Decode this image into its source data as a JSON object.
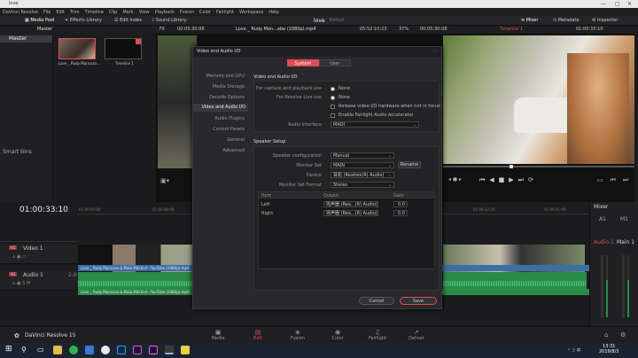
{
  "window": {
    "title": "love"
  },
  "menu": [
    "DaVinci Resolve",
    "File",
    "Edit",
    "Trim",
    "Timeline",
    "Clip",
    "Mark",
    "View",
    "Playback",
    "Fusion",
    "Color",
    "Fairlight",
    "Workspace",
    "Help"
  ],
  "toolbar": {
    "media_pool": "Media Pool",
    "effects_library": "Effects Library",
    "edit_index": "Edit Index",
    "sound_library": "Sound Library",
    "project_name": "love",
    "project_status": "Edited",
    "mixer": "Mixer",
    "metadata": "Metadata",
    "inspector": "Inspector"
  },
  "subbar": {
    "bin": "Master",
    "fit": "Fit",
    "source_tc": "00:05:30:08",
    "clip_name": "Love _ Rudy Man...abe (1080p).mp4",
    "duration_tc": "05:52:10:23",
    "zoom": "37%",
    "rec_tc": "00:05:30:08",
    "timeline_name": "Timeline 1",
    "timeline_tc": "01:00:33:10"
  },
  "left_panel": {
    "master": "Master",
    "smart_bins": "Smart Bins"
  },
  "media_pool": {
    "clips": [
      {
        "name": "Love _ Rudy Mancuso..."
      },
      {
        "name": "Timeline 1"
      }
    ]
  },
  "timeline": {
    "timecode": "01:00:33:10",
    "ruler": [
      "01:00:00:00",
      "01:00:08:08",
      "01:00:32:20",
      "01:00:41:00"
    ],
    "tracks": [
      {
        "id": "V1",
        "name": "Video 1"
      },
      {
        "id": "A1",
        "name": "Audio 1",
        "level": "2.0"
      }
    ],
    "clip_label": "Love _ Rudy Mancuso & Maia Mitchell - YouTube (1080p).mp4"
  },
  "mixer": {
    "title": "Mixer",
    "ch1": "A1",
    "ch2": "M1",
    "bus1": "Audio 1",
    "bus2": "Main 1"
  },
  "pages": [
    {
      "label": "Media",
      "icon": "▣"
    },
    {
      "label": "Edit",
      "icon": "▤"
    },
    {
      "label": "Fusion",
      "icon": "◈"
    },
    {
      "label": "Color",
      "icon": "◉"
    },
    {
      "label": "Fairlight",
      "icon": "♫"
    },
    {
      "label": "Deliver",
      "icon": "➚"
    }
  ],
  "app_brand": "DaVinci Resolve 15",
  "clock": {
    "time": "13:31",
    "date": "2019/8/3"
  },
  "dialog": {
    "title": "Video and Audio I/O",
    "tabs": [
      "System",
      "User"
    ],
    "nav": [
      "Memory and GPU",
      "Media Storage",
      "Decode Options",
      "Video and Audio I/O",
      "Audio Plugins",
      "Control Panels",
      "General",
      "Advanced"
    ],
    "section_io": "Video and Audio I/O",
    "capture_label": "For capture and playback use",
    "capture_value": "None",
    "resolve_live_label": "For Resolve Live use",
    "resolve_live_value": "None",
    "release_io": "Release video I/O hardware when not in focus",
    "fairlight_accel": "Enable Fairlight Audio Accelerator",
    "audio_interface_label": "Audio Interface",
    "audio_interface_value": "MADI",
    "section_speaker": "Speaker Setup",
    "speaker_config_label": "Speaker configuration",
    "speaker_config_value": "Manual",
    "monitor_set_label": "Monitor Set",
    "monitor_set_value": "MAIN",
    "rename": "Rename",
    "device_label": "Device",
    "device_value": "耳机 (Realtek(R) Audio)",
    "format_label": "Monitor Set Format",
    "format_value": "Stereo",
    "table_headers": [
      "Item",
      "Output",
      "Gain"
    ],
    "rows": [
      {
        "item": "Left",
        "output": "扬声器 (Rea...(R) Audio)",
        "gain": "0.0"
      },
      {
        "item": "Right",
        "output": "扬声器 (Rea...(R) Audio)",
        "gain": "0.0"
      }
    ],
    "cancel": "Cancel",
    "save": "Save"
  },
  "colors": {
    "accent": "#e04c58",
    "audio": "#2a8a48",
    "clip": "#3b6fa8"
  }
}
